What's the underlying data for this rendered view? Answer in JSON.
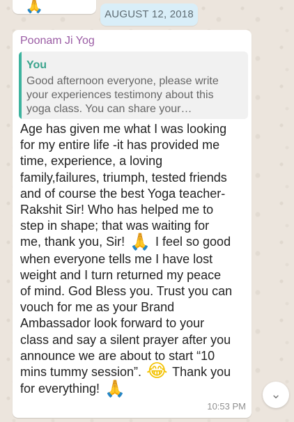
{
  "chat": {
    "date_label": "AUGUST 12, 2018",
    "previous_message_emoji": "🙏",
    "message": {
      "sender": "Poonam Ji Yog",
      "quoted_message": {
        "author": "You",
        "text_lines": [
          "Good afternoon everyone, please write",
          "your experiences testimony about this",
          "yoga class. You can share your…"
        ]
      },
      "body_lines": [
        "Age has given me what I was looking",
        "for my entire life -it has provided me",
        "time, experience, a loving",
        "family,failures, triumph, tested friends",
        "and of course the best Yoga teacher-",
        "Rakshit Sir! Who has helped me to",
        "step in shape; that was waiting for",
        "me, thank you, Sir!",
        "I feel so good",
        "when everyone tells me I have lost",
        "weight and I turn returned my peace",
        "of mind. God Bless you. Trust you can",
        "vouch for me as your Brand",
        "Ambassador look forward to your",
        "class and say a silent prayer after you",
        "announce we are about to start “10",
        "mins tummy session”.",
        "Thank you",
        "for everything!"
      ],
      "emojis": {
        "pray": "🙏",
        "joy": "😂"
      },
      "timestamp": "10:53 PM"
    },
    "scroll_down_icon": "double-chevron-down-icon"
  }
}
